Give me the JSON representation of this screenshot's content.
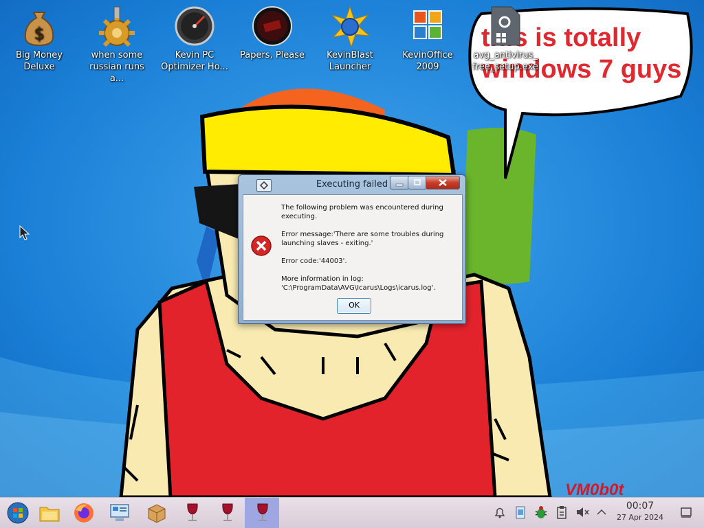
{
  "desktop": {
    "icons": [
      {
        "label_line1": "Big Money",
        "label_line2": "Deluxe",
        "icon": "money-bag-icon"
      },
      {
        "label_line1": "when some",
        "label_line2": "russian runs a...",
        "icon": "gear-icon"
      },
      {
        "label_line1": "Kevin PC",
        "label_line2": "Optimizer Ho...",
        "icon": "gauge-icon"
      },
      {
        "label_line1": "Papers, Please",
        "label_line2": "",
        "icon": "papers-please-icon"
      },
      {
        "label_line1": "KevinBlast",
        "label_line2": "Launcher",
        "icon": "blast-icon"
      },
      {
        "label_line1": "KevinOffice",
        "label_line2": "2009",
        "icon": "office-icon"
      },
      {
        "label_line1": "avg_antivirus_",
        "label_line2": "free_setup.exe",
        "icon": "setup-file-icon"
      }
    ],
    "speech_bubble": {
      "line1": "this is totally",
      "line2": "windows 7 guys"
    },
    "watermark": "VM0b0t"
  },
  "dialog": {
    "title": "Executing failed",
    "line1": "The following problem was encountered during",
    "line2": "executing.",
    "line3": "Error message:'There are some troubles during",
    "line4": "launching slaves - exiting.'",
    "line5": "Error code:'44003'.",
    "line6": "More information in log:",
    "line7": "'C:\\ProgramData\\AVG\\Icarus\\Logs\\icarus.log'.",
    "ok_label": "OK"
  },
  "taskbar": {
    "items": [
      "start-orb-icon",
      "file-manager-icon",
      "firefox-icon",
      "control-panel-icon",
      "package-icon",
      "wine-glass-icon",
      "wine-glass-icon",
      "wine-glass-icon"
    ],
    "clock": {
      "time": "00:07",
      "date": "27 Apr 2024"
    }
  },
  "colors": {
    "bubble_text": "#e0282e",
    "dialog_title": "#a9c4de",
    "taskbar": "#e2d7e1"
  }
}
